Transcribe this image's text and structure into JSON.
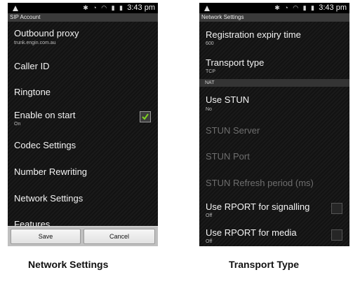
{
  "left_screen": {
    "status_time": "3:43 pm",
    "title": "SIP Account",
    "items": [
      {
        "label": "Outbound proxy",
        "sub": "trunk.engin.com.au"
      },
      {
        "label": "Caller ID"
      },
      {
        "label": "Ringtone"
      },
      {
        "label": "Enable on start",
        "sub": "On",
        "checked": true
      },
      {
        "label": "Codec Settings"
      },
      {
        "label": "Number Rewriting"
      },
      {
        "label": "Network Settings"
      },
      {
        "label": "Features"
      }
    ],
    "buttons": {
      "save": "Save",
      "cancel": "Cancel"
    }
  },
  "right_screen": {
    "status_time": "3:43 pm",
    "title": "Network Settings",
    "items": [
      {
        "label": "Registration expiry time",
        "sub": "600"
      },
      {
        "label": "Transport type",
        "sub": "TCP"
      },
      {
        "section": "NAT"
      },
      {
        "label": "Use STUN",
        "sub": "No"
      },
      {
        "label": "STUN Server",
        "disabled": true
      },
      {
        "label": "STUN Port",
        "disabled": true
      },
      {
        "label": "STUN Refresh period (ms)",
        "disabled": true
      },
      {
        "label": "Use RPORT for signalling",
        "sub": "Off",
        "checked": false
      },
      {
        "label": "Use RPORT for media",
        "sub": "Off",
        "checked": false
      }
    ]
  },
  "captions": {
    "left": "Network Settings",
    "right": "Transport Type"
  },
  "colors": {
    "check": "#7ed321",
    "background": "#0d0d0d"
  }
}
